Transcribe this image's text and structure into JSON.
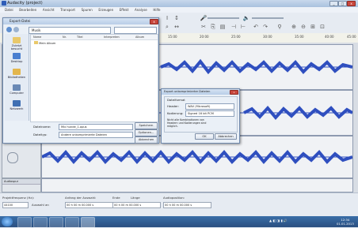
{
  "app": {
    "title": "Audacity (project)",
    "menu": [
      "Datei",
      "Bearbeiten",
      "Ansicht",
      "Transport",
      "Spuren",
      "Erzeugen",
      "Effekt",
      "Analyse",
      "Hilfe"
    ]
  },
  "timeline": {
    "ticks": [
      "15:00",
      "20:00",
      "25:00",
      "30:00",
      "35:00",
      "40:00",
      "45:00"
    ]
  },
  "tracks": [
    {
      "name": "Audiospur",
      "scale": [
        "1,0",
        "0,0",
        "-1,0"
      ]
    },
    {
      "name": "Audiospur",
      "scale": [
        "1,0",
        "0,0",
        "-1,0"
      ]
    },
    {
      "name": "Audiospur",
      "scale": [
        "1,0",
        "0,0",
        "-1,0"
      ]
    }
  ],
  "save_dialog": {
    "title": "Export-Datei",
    "address": "Musik",
    "columns": [
      "Name",
      "Nr.",
      "Titel",
      "Interpreten",
      "Album"
    ],
    "item": "Mein Album",
    "sidebar": [
      "Zuletzt besucht",
      "Desktop",
      "Bibliotheken",
      "Computer",
      "Netzwerk"
    ],
    "filename_label": "Dateiname:",
    "filename_value": "Mix hunde_1.opus",
    "filetype_label": "Dateityp:",
    "filetype_value": "Andere unkomprimierte Dateien",
    "btn_save": "Speichern",
    "btn_options": "Optionen...",
    "btn_cancel": "Abbrechen"
  },
  "options_dialog": {
    "title": "Export unkomprimierter Dateien",
    "group": "Dateiformat",
    "header_label": "Header:",
    "header_value": "WAV (Microsoft)",
    "encoding_label": "Kodierung:",
    "encoding_value": "Signed 16 bit PCM",
    "note": "Nicht alle Kombinationen von Headern und Kodierungen sind möglich.",
    "ok": "OK",
    "cancel": "Abbrechen"
  },
  "bottom": {
    "rate_label": "Projektfrequenz (Hz):",
    "rate_value": "44100",
    "snap_label": "Auswahl an",
    "selection_label": "Anfang der Auswahl:",
    "selection_value": "00 h 00 m 00.000 s",
    "end_label": "Ende",
    "length_label": "Länge",
    "end_value": "00 h 00 m 00.000 s",
    "audio_pos_label": "Audioposition:",
    "audio_pos_value": "00 h 00 m 00.000 s"
  },
  "taskbar": {
    "clock_time": "12:34",
    "clock_date": "01.01.2013"
  },
  "colors": {
    "waveform": "#2f4fbf",
    "taskbar": "#2a4f80"
  }
}
